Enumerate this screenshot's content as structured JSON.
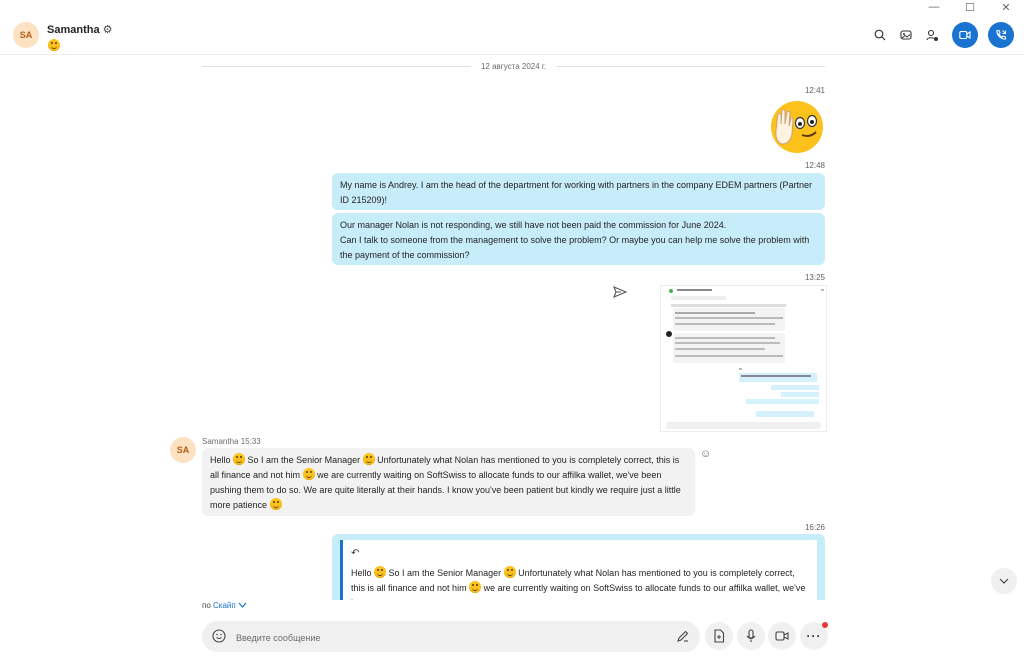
{
  "header": {
    "avatar_initials": "SA",
    "contact_name": "Samantha",
    "mood_icon": "smiley-emoji"
  },
  "chat": {
    "date_separator": "12 августа 2024 г.",
    "messages": [
      {
        "time": "12:41",
        "type": "emoji",
        "icon": "waving-hand-face-emoji"
      },
      {
        "time": "12:48",
        "text": "My name is Andrey. I am the head of the department for working with partners in the company EDEM partners (Partner ID 215209)!"
      },
      {
        "text_lines": [
          "Our manager Nolan is not responding, we still have not been paid the commission for June 2024.",
          "Can I talk to someone from the management to solve the problem? Or maybe you can help me solve the problem with the payment of the commission?"
        ]
      },
      {
        "time": "13:25",
        "type": "image"
      },
      {
        "sender": "Samantha",
        "time": "15:33",
        "avatar_initials": "SA",
        "parts": [
          "Hello",
          "So I am the Senior Manager",
          "Unfortunately what Nolan has mentioned to you is completely correct, this is all finance and not him",
          "we are currently waiting on SoftSwiss to allocate funds to our affilka wallet, we've been pushing them to do so. We are quite literally at their hands. I know you've been patient but kindly we require just a little more patience"
        ]
      },
      {
        "time": "16:26",
        "quote_parts": [
          "Hello",
          "So I am the Senior Manager",
          "Unfortunately what Nolan has mentioned to you is completely correct, this is all finance and not him",
          "we are currently waiting on SoftSwiss to allocate funds to our affilka wallet, we've been"
        ]
      }
    ]
  },
  "footer": {
    "via_prefix": "по",
    "via_link": "Скайп",
    "composer_placeholder": "Введите сообщение"
  },
  "colors": {
    "accent": "#1a73d1",
    "outgoing_bubble": "#c7ecfa",
    "incoming_bubble": "#f2f2f2"
  }
}
